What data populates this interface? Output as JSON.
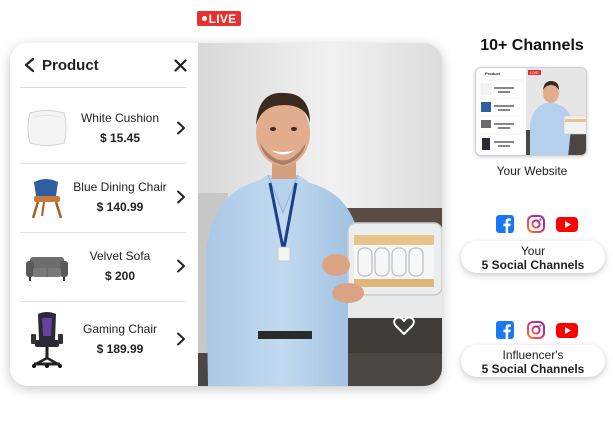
{
  "panel": {
    "title": "Product",
    "products": [
      {
        "name": "White Cushion",
        "price": "$ 15.45"
      },
      {
        "name": "Blue Dining Chair",
        "price": "$ 140.99"
      },
      {
        "name": "Velvet Sofa",
        "price": "$ 200"
      },
      {
        "name": "Gaming Chair",
        "price": "$ 189.99"
      }
    ]
  },
  "video": {
    "live_label": "LIVE"
  },
  "channels": {
    "title": "10+ Channels",
    "website_label": "Your Website",
    "own": {
      "line1": "Your",
      "line2": "5 Social Channels"
    },
    "influencer": {
      "line1": "Influencer's",
      "line2": "5 Social Channels"
    }
  },
  "mini": {
    "title": "Product",
    "live_label": "LIVE"
  },
  "colors": {
    "live_red": "#e8302f",
    "facebook": "#1877f2",
    "youtube": "#ff0000",
    "instagram_orange": "#f58529",
    "instagram_purple": "#8134af"
  }
}
